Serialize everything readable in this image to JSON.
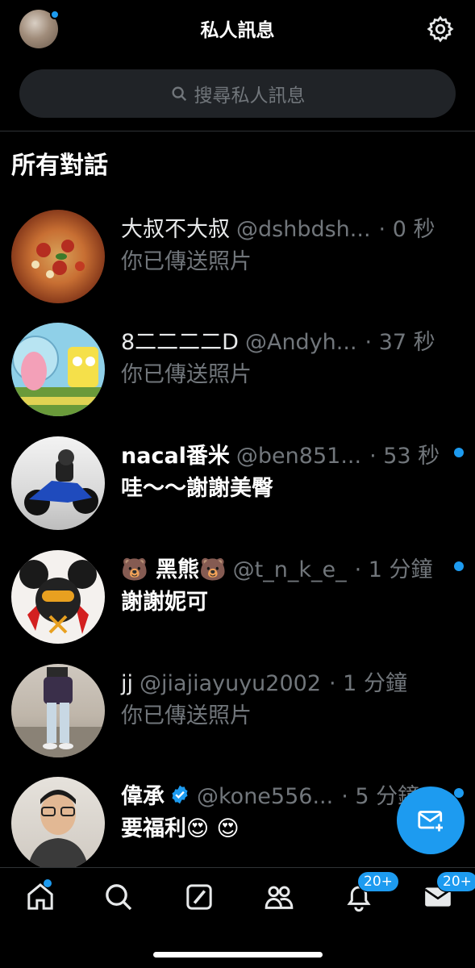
{
  "header": {
    "title": "私人訊息"
  },
  "search": {
    "placeholder": "搜尋私人訊息"
  },
  "section": {
    "title": "所有對話"
  },
  "conversations": [
    {
      "name": "大叔不大叔",
      "handle": "@dshbdsh...",
      "time": "· 0 秒",
      "preview": "你已傳送照片",
      "unread": false
    },
    {
      "name": "8二二二二D",
      "handle": "@Andyh...",
      "time": "· 37 秒",
      "preview": "你已傳送照片",
      "unread": false
    },
    {
      "name": "nacal番米",
      "handle": "@ben851...",
      "time": "· 53 秒",
      "preview": "哇～～謝謝美臀",
      "unread": true
    },
    {
      "name": "🐻 黑熊🐻",
      "handle": "@t_n_k_e_",
      "time": "· 1 分鐘",
      "preview": "謝謝妮可",
      "unread": true
    },
    {
      "name": "jj",
      "handle": "@jiajiayuyu2002",
      "time": "· 1 分鐘",
      "preview": "你已傳送照片",
      "unread": false
    },
    {
      "name": "偉承",
      "handle": "@kone556...",
      "time": "· 5 分鐘",
      "preview": "要福利😍 😍",
      "unread": true
    }
  ],
  "tabbar": {
    "notifications_badge": "20+",
    "messages_badge": "20+"
  },
  "colors": {
    "accent": "#1d9bf0",
    "background": "#000000",
    "muted": "#71767b"
  }
}
